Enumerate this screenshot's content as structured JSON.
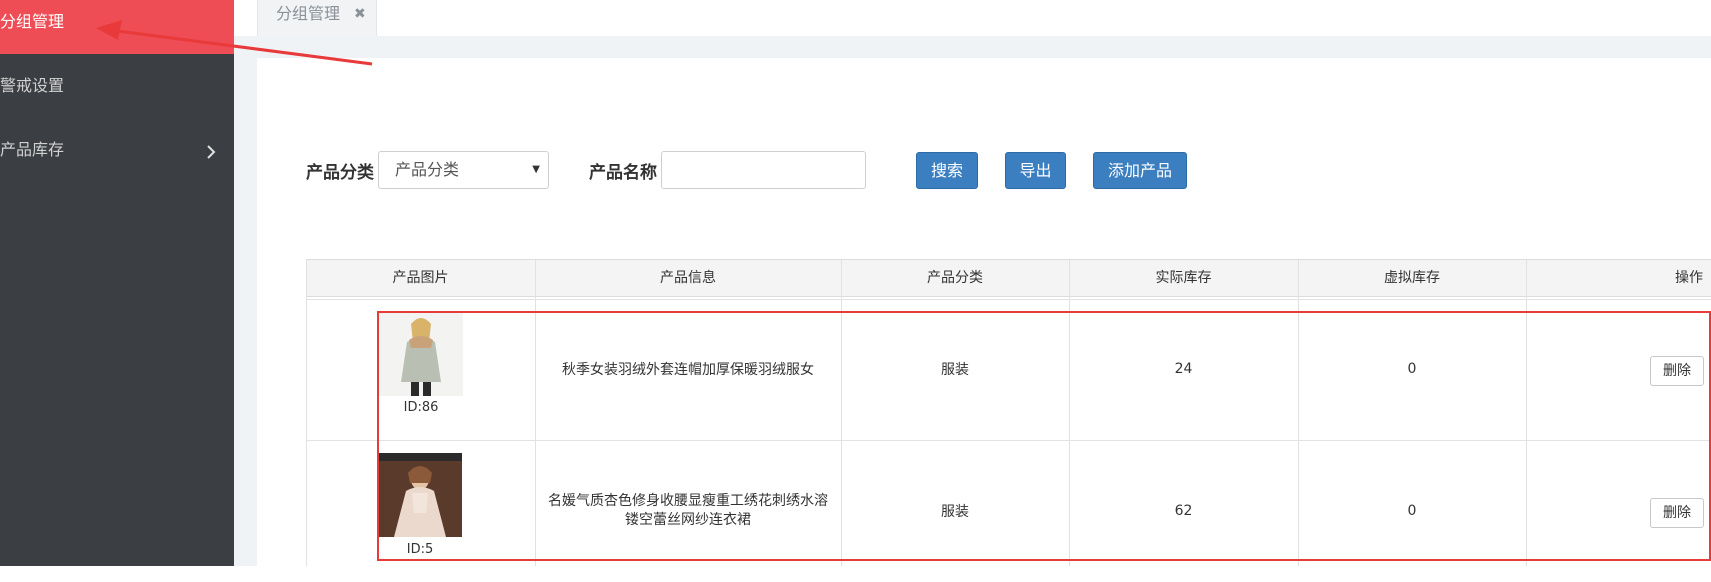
{
  "sidebar": {
    "items": [
      {
        "label": "分组管理",
        "active": true
      },
      {
        "label": "警戒设置",
        "active": false
      },
      {
        "label": "产品库存",
        "active": false
      }
    ]
  },
  "tabs": [
    {
      "label": "分组管理",
      "close": "✖"
    }
  ],
  "filters": {
    "category_label": "产品分类",
    "category_value": "产品分类",
    "name_label": "产品名称",
    "name_value": "",
    "search_btn": "搜索",
    "export_btn": "导出",
    "add_btn": "添加产品"
  },
  "table": {
    "columns": [
      "产品图片",
      "产品信息",
      "产品分类",
      "实际库存",
      "虚拟库存",
      "操作"
    ],
    "rows": [
      {
        "id": "ID:86",
        "info": "秋季女装羽绒外套连帽加厚保暖羽绒服女",
        "category": "服装",
        "actual": "24",
        "virtual": "0",
        "action": "删除"
      },
      {
        "id": "ID:5",
        "info": "名媛气质杏色修身收腰显瘦重工绣花刺绣水溶镂空蕾丝网纱连衣裙",
        "category": "服装",
        "actual": "62",
        "virtual": "0",
        "action": "删除"
      }
    ]
  },
  "colors": {
    "sidebar_bg": "#3b3e43",
    "active_bg": "#ef4d55",
    "primary_btn": "#3b7fc1",
    "highlight": "#e83a3a"
  }
}
